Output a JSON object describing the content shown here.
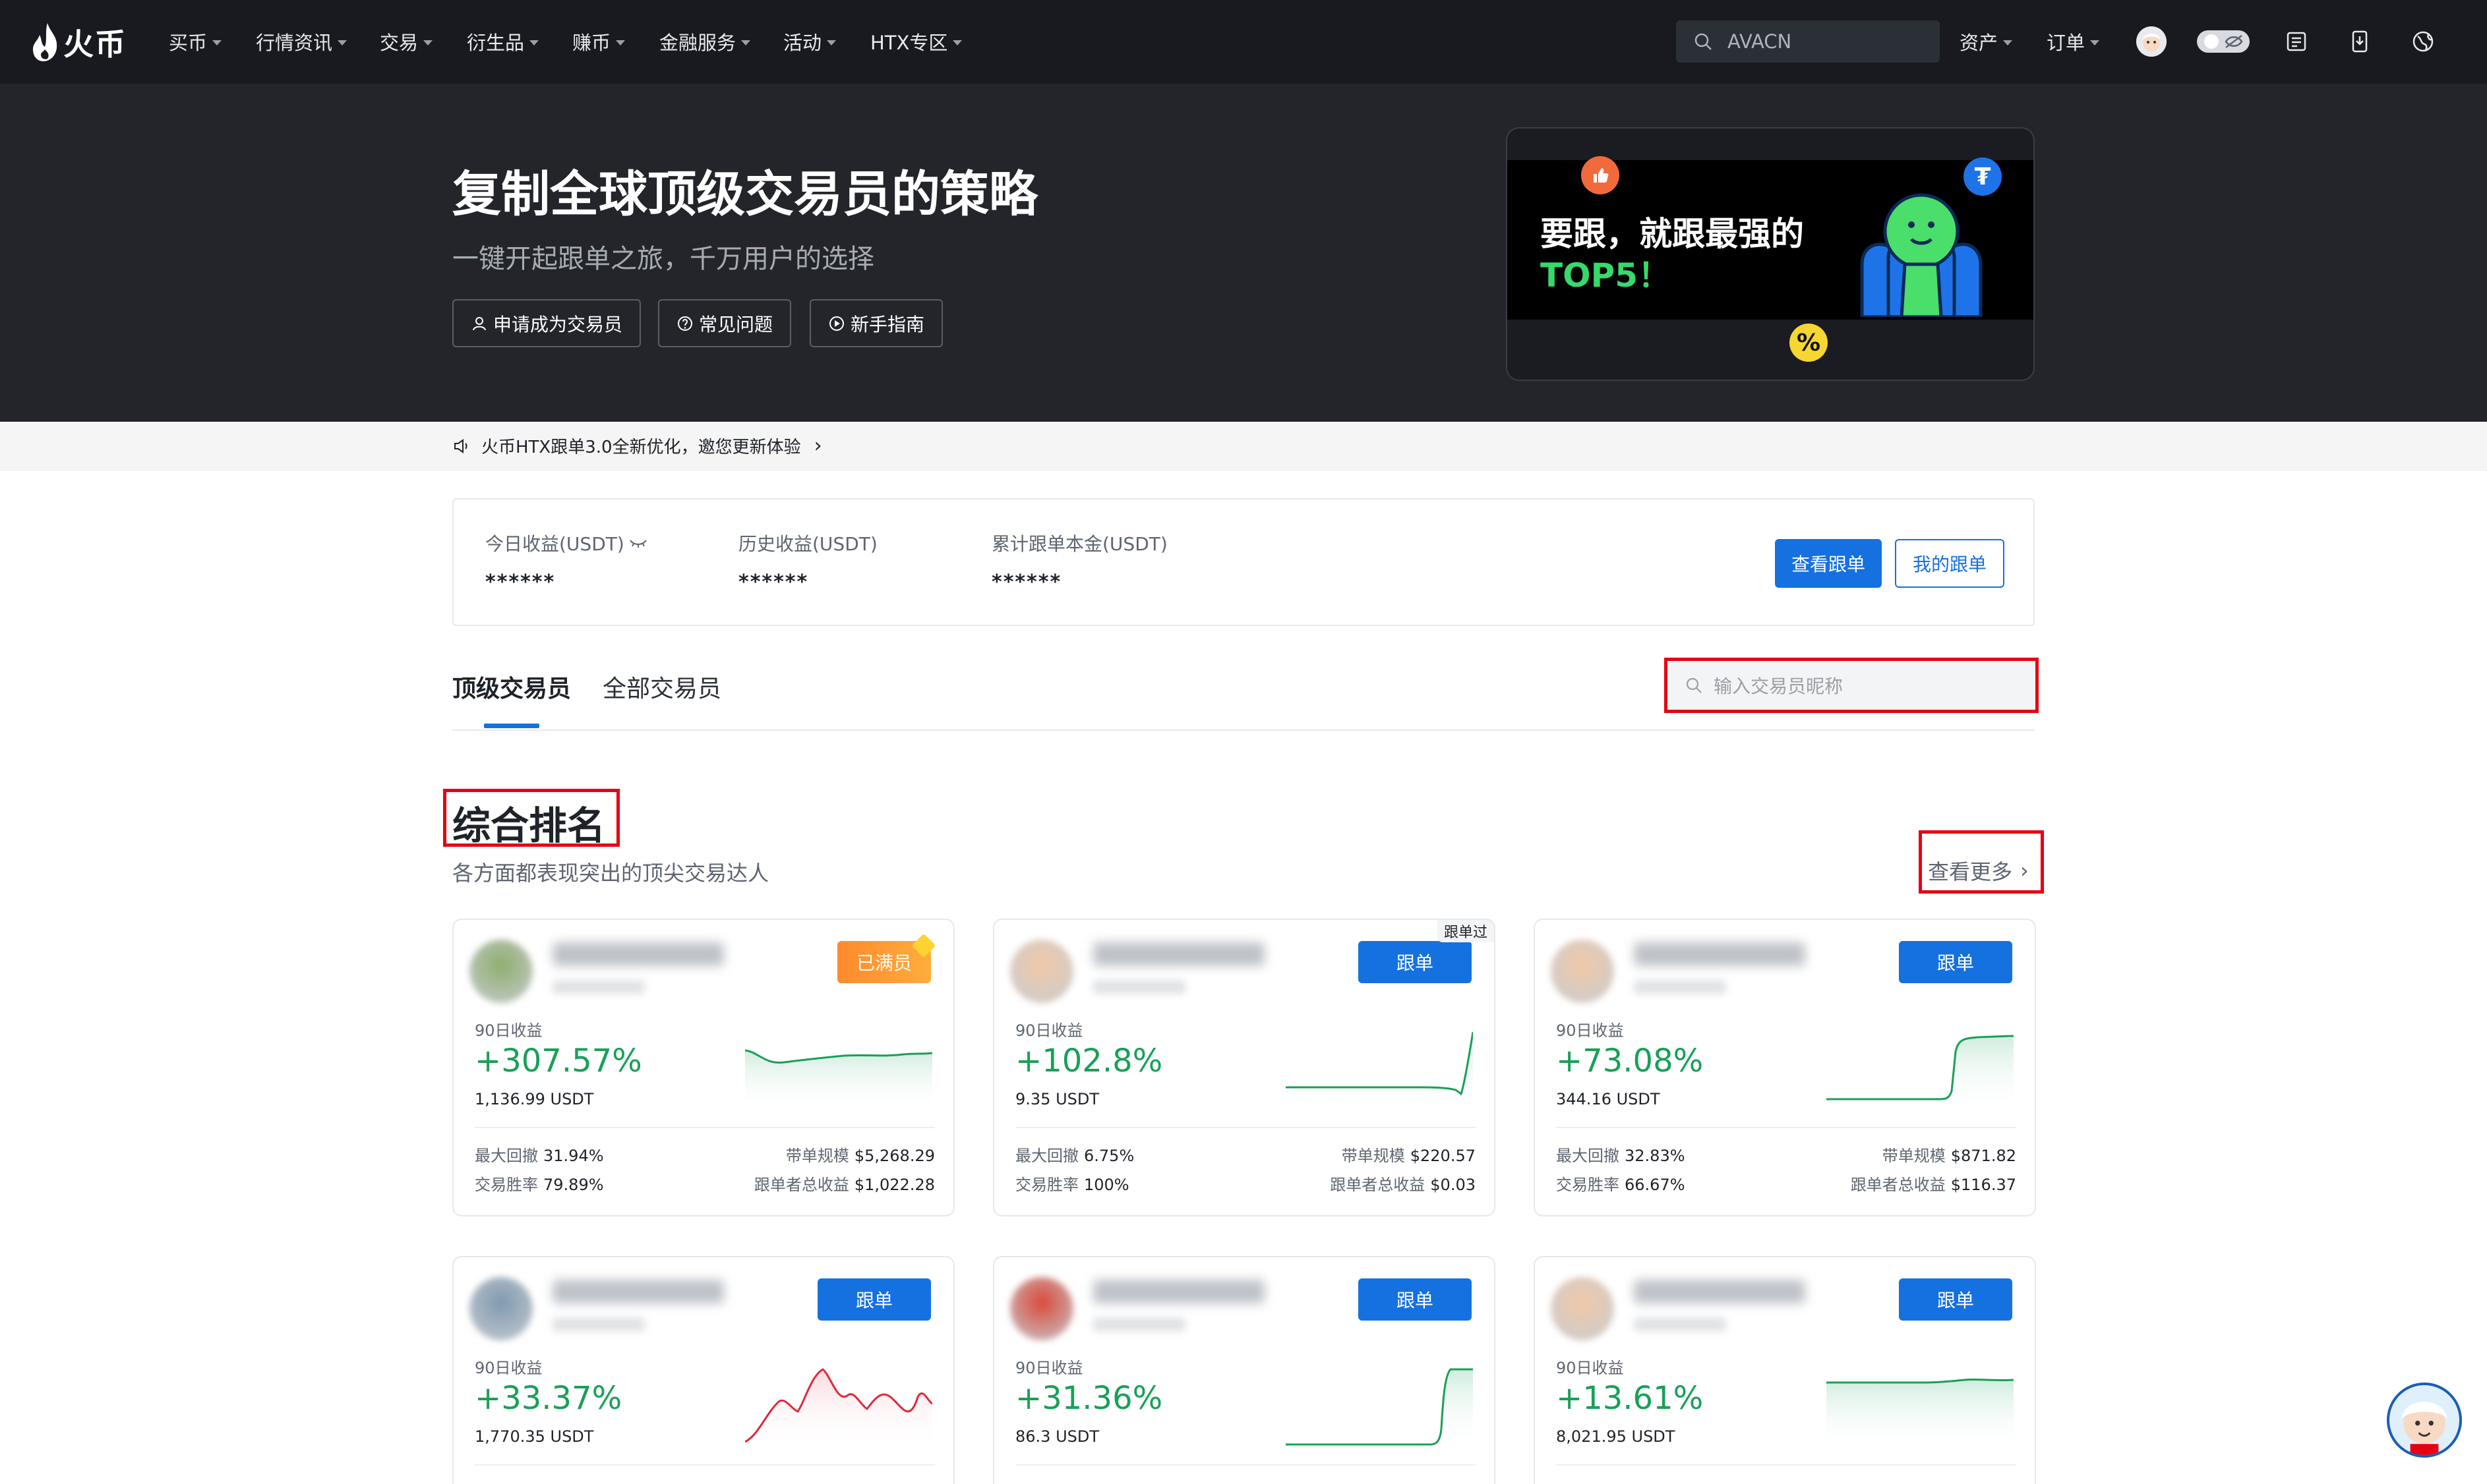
{
  "nav": {
    "logo_text": "火币",
    "items": [
      "买币",
      "行情资讯",
      "交易",
      "衍生品",
      "赚币",
      "金融服务",
      "活动",
      "HTX专区"
    ],
    "search_value": "AVACN",
    "assets_label": "资产",
    "orders_label": "订单"
  },
  "hero": {
    "title": "复制全球顶级交易员的策略",
    "subtitle": "一键开起跟单之旅，千万用户的选择",
    "buttons": [
      "申请成为交易员",
      "常见问题",
      "新手指南"
    ],
    "banner_line1": "要跟，就跟最强的",
    "banner_line2": "TOP5！",
    "banner_tether_symbol": "₮",
    "banner_percent_symbol": "%"
  },
  "notice": {
    "text": "火币HTX跟单3.0全新优化，邀您更新体验",
    "arrow": "›"
  },
  "summary": {
    "today_label": "今日收益(USDT)",
    "history_label": "历史收益(USDT)",
    "principal_label": "累计跟单本金(USDT)",
    "masked": "******",
    "view_button": "查看跟单",
    "my_button": "我的跟单"
  },
  "tabs": {
    "top": "顶级交易员",
    "all": "全部交易员",
    "search_placeholder": "输入交易员昵称"
  },
  "section": {
    "title": "综合排名",
    "subtitle": "各方面都表现突出的顶尖交易达人",
    "more": "查看更多",
    "more_chevron": "›"
  },
  "card_labels": {
    "roi_90d": "90日收益",
    "max_drawdown": "最大回撤",
    "win_rate": "交易胜率",
    "aum": "带单规模",
    "follower_pnl": "跟单者总收益",
    "follow": "跟单",
    "full": "已满员",
    "followed_tag": "跟单过"
  },
  "cards": [
    {
      "roi": "+307.57%",
      "amount": "1,136.99 USDT",
      "drawdown": "31.94%",
      "win_rate": "79.89%",
      "aum": "$5,268.29",
      "follower_pnl": "$1,022.28",
      "status": "full",
      "trend": "down",
      "avatar_color": "#8fae6e"
    },
    {
      "roi": "+102.8%",
      "amount": "9.35 USDT",
      "drawdown": "6.75%",
      "win_rate": "100%",
      "aum": "$220.57",
      "follower_pnl": "$0.03",
      "status": "follow",
      "tag": "跟单过",
      "trend": "up",
      "avatar_color": "#f0c9a8"
    },
    {
      "roi": "+73.08%",
      "amount": "344.16 USDT",
      "drawdown": "32.83%",
      "win_rate": "66.67%",
      "aum": "$871.82",
      "follower_pnl": "$116.37",
      "status": "follow",
      "trend": "up",
      "avatar_color": "#f0c9a8"
    },
    {
      "roi": "+33.37%",
      "amount": "1,770.35 USDT",
      "status": "follow",
      "trend": "down",
      "avatar_color": "#7f9ab0"
    },
    {
      "roi": "+31.36%",
      "amount": "86.3 USDT",
      "status": "follow",
      "trend": "up",
      "avatar_color": "#d94a3a"
    },
    {
      "roi": "+13.61%",
      "amount": "8,021.95 USDT",
      "status": "follow",
      "trend": "up",
      "avatar_color": "#f0c9a8"
    }
  ],
  "colors": {
    "brand_blue": "#1571e0",
    "gain_green": "#18a058",
    "loss_red": "#e0283b",
    "highlight_red": "#e60012"
  }
}
